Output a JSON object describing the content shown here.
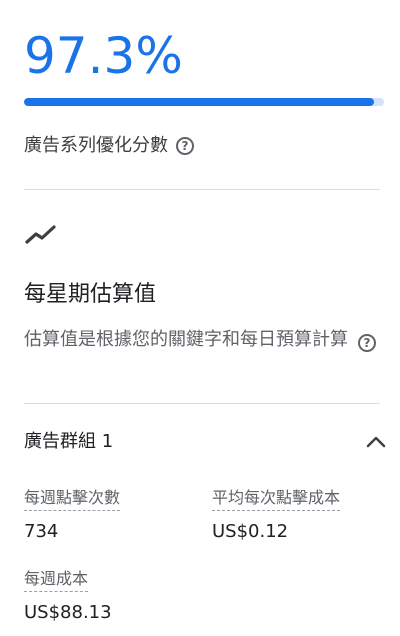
{
  "optimization": {
    "score_text": "97.3%",
    "score_fraction": 0.973,
    "label": "廣告系列優化分數"
  },
  "estimates": {
    "title": "每星期估算值",
    "description": "估算值是根據您的關鍵字和每日預算計算"
  },
  "ad_group": {
    "title": "廣告群組 1",
    "metrics": [
      {
        "label": "每週點擊次數",
        "value": "734"
      },
      {
        "label": "平均每次點擊成本",
        "value": "US$0.12"
      },
      {
        "label": "每週成本",
        "value": "US$88.13"
      }
    ]
  },
  "colors": {
    "accent": "#1a73e8",
    "track": "#d2e3fc"
  },
  "icons": {
    "help": "help-circle-icon",
    "trend": "trending-up-icon",
    "collapse": "chevron-up-icon"
  }
}
